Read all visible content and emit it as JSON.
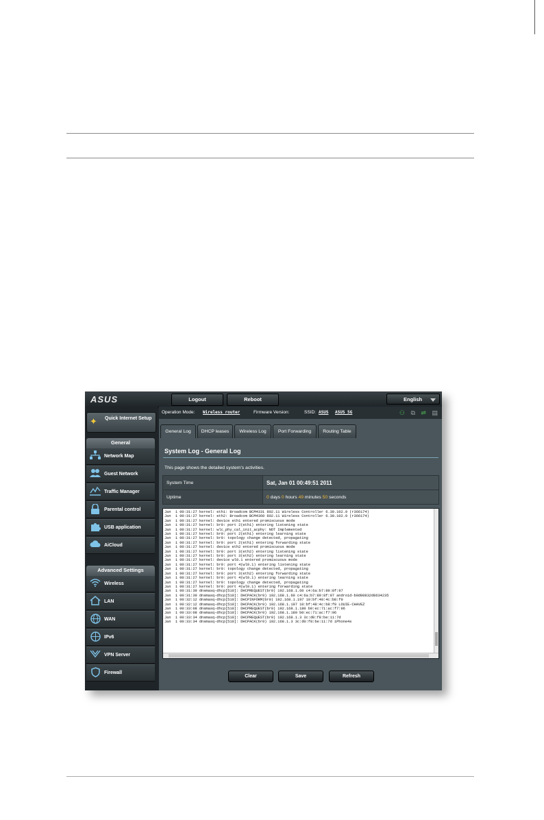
{
  "brand": "ASUS",
  "topbar": {
    "logout": "Logout",
    "reboot": "Reboot",
    "language": "English"
  },
  "quick_setup": "Quick Internet Setup",
  "sidebar": {
    "general_header": "General",
    "general_items": [
      {
        "label": "Network Map",
        "icon": "network-map-icon"
      },
      {
        "label": "Guest Network",
        "icon": "guest-network-icon"
      },
      {
        "label": "Traffic Manager",
        "icon": "traffic-manager-icon"
      },
      {
        "label": "Parental control",
        "icon": "lock-icon"
      },
      {
        "label": "USB application",
        "icon": "puzzle-icon"
      },
      {
        "label": "AiCloud",
        "icon": "cloud-icon"
      }
    ],
    "advanced_header": "Advanced Settings",
    "advanced_items": [
      {
        "label": "Wireless",
        "icon": "wifi-icon"
      },
      {
        "label": "LAN",
        "icon": "home-icon"
      },
      {
        "label": "WAN",
        "icon": "globe-icon"
      },
      {
        "label": "IPv6",
        "icon": "ipv6-globe-icon"
      },
      {
        "label": "VPN Server",
        "icon": "vpn-icon"
      },
      {
        "label": "Firewall",
        "icon": "shield-icon"
      }
    ]
  },
  "info": {
    "op_mode_label": "Operation Mode:",
    "op_mode_value": "Wireless router",
    "fw_label": "Firmware Version:",
    "ssid_label": "SSID:",
    "ssid_1": "ASUS",
    "ssid_2": "ASUS_5G"
  },
  "tabs": [
    "General Log",
    "DHCP leases",
    "Wireless Log",
    "Port Forwarding",
    "Routing Table"
  ],
  "page": {
    "title": "System Log - General Log",
    "description": "This page shows the detailed system's activities.",
    "system_time_label": "System Time",
    "system_time_value": "Sat, Jan 01  00:49:51  2011",
    "uptime_label": "Uptime",
    "uptime": {
      "days": "0",
      "days_label": " days ",
      "hours": "0",
      "hours_label": " hours ",
      "minutes": "49",
      "minutes_label": " minutes ",
      "seconds": "50",
      "seconds_label": " seconds"
    }
  },
  "log_lines": [
    "Jan  1 00:31:27 kernel: eth1: Broadcom BCM4331 802.11 Wireless Controller 6.30.102.9 (r366174)",
    "Jan  1 00:31:27 kernel: eth2: Broadcom BCM4360 802.11 Wireless Controller 6.30.102.9 (r366174)",
    "Jan  1 00:31:27 kernel: device eth1 entered promiscuous mode",
    "Jan  1 00:31:27 kernel: br0: port 2(eth1) entering listening state",
    "Jan  1 00:31:27 kernel: wlc_phy_cal_init_acphy: NOT Implemented",
    "Jan  1 00:31:27 kernel: br0: port 2(eth1) entering learning state",
    "Jan  1 00:31:27 kernel: br0: topology change detected, propagating",
    "Jan  1 00:31:27 kernel: br0: port 2(eth1) entering forwarding state",
    "Jan  1 00:31:27 kernel: device eth2 entered promiscuous mode",
    "Jan  1 00:31:27 kernel: br0: port 3(eth2) entering listening state",
    "Jan  1 00:31:27 kernel: br0: port 3(eth2) entering learning state",
    "Jan  1 00:31:27 kernel: device wl0.1 entered promiscuous mode",
    "Jan  1 00:31:27 kernel: br0: port 4(wl0.1) entering listening state",
    "Jan  1 00:31:27 kernel: br0: topology change detected, propagating",
    "Jan  1 00:31:27 kernel: br0: port 3(eth2) entering forwarding state",
    "Jan  1 00:31:27 kernel: br0: port 4(wl0.1) entering learning state",
    "Jan  1 00:31:27 kernel: br0: topology change detected, propagating",
    "Jan  1 00:31:27 kernel: br0: port 4(wl0.1) entering forwarding state",
    "Jan  1 00:31:39 dnsmasq-dhcp[510]: DHCPREQUEST(br0) 192.168.1.60 c4:6a:b7:89:8f:97",
    "Jan  1 00:31:39 dnsmasq-dhcp[510]: DHCPACK(br0) 192.168.1.60 c4:6a:b7:89:8f:97 android-b0d00832d8634235",
    "Jan  1 00:32:12 dnsmasq-dhcp[510]: DHCPINFORM(br0) 192.168.1.197 10:bf:48:4c:b8:f0",
    "Jan  1 00:32:12 dnsmasq-dhcp[510]: DHCPACK(br0) 192.168.1.197 10:bf:48:4c:b8:f0 LOUIE-CHAVEZ",
    "Jan  1 00:33:08 dnsmasq-dhcp[510]: DHCPREQUEST(br0) 192.168.1.180 b0:ec:71:ac:f7:96",
    "Jan  1 00:33:08 dnsmasq-dhcp[510]: DHCPACK(br0) 192.168.1.180 b0:ec:71:ac:f7:96",
    "Jan  1 00:33:34 dnsmasq-dhcp[510]: DHCPREQUEST(br0) 192.168.1.3 3c:d0:f8:be:11:7d",
    "Jan  1 00:33:34 dnsmasq-dhcp[510]: DHCPACK(br0) 192.168.1.3 3c:d0:f8:be:11:7d iPhone4s"
  ],
  "buttons": {
    "clear": "Clear",
    "save": "Save",
    "refresh": "Refresh"
  },
  "colors": {
    "highlight": "#f0b83c",
    "icon_blue": "#7fc3e8",
    "status_green": "#4caf50"
  }
}
